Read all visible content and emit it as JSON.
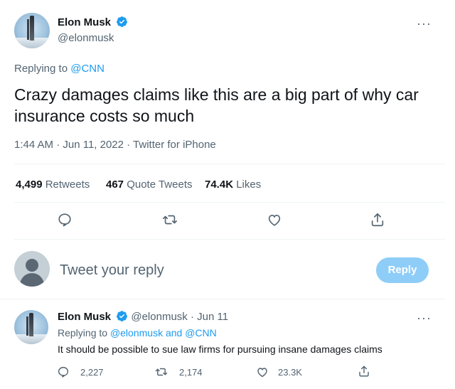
{
  "main_tweet": {
    "author": {
      "name": "Elon Musk",
      "handle": "@elonmusk",
      "verified": true,
      "more_icon": "more-dots-icon"
    },
    "replying_to": {
      "prefix": "Replying to ",
      "mention": "@CNN"
    },
    "text": "Crazy damages claims like this are a big part of why car insurance costs so much",
    "meta": "1:44 AM · Jun 11, 2022 · Twitter for iPhone",
    "stats": {
      "retweets_count": "4,499",
      "retweets_label": "Retweets",
      "quote_count": "467",
      "quote_label": "Quote Tweets",
      "likes_count": "74.4K",
      "likes_label": "Likes"
    },
    "actions": [
      "reply-icon",
      "retweet-icon",
      "like-icon",
      "share-icon"
    ]
  },
  "composer": {
    "placeholder": "Tweet your reply",
    "button_label": "Reply",
    "avatar_icon": "default-avatar-icon"
  },
  "reply_tweet": {
    "author": {
      "name": "Elon Musk",
      "handle": "@elonmusk",
      "date": "· Jun 11",
      "verified": true
    },
    "replying_to": {
      "prefix": "Replying to ",
      "mentions": "@elonmusk and @CNN"
    },
    "text": "It should be possible to sue law firms for pursuing insane damages claims",
    "actions": {
      "replies": "2,227",
      "retweets": "2,174",
      "likes": "23.3K"
    }
  },
  "colors": {
    "accent": "#1d9bf0",
    "reply_button_disabled": "#8ecdf8",
    "muted_text": "#536471",
    "divider": "#eff3f4"
  }
}
